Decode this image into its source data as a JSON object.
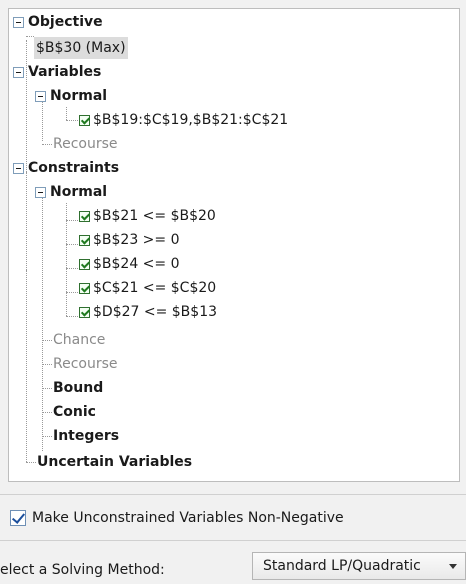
{
  "tree": {
    "objective": {
      "label": "Objective",
      "value": "$B$30 (Max)"
    },
    "variables": {
      "label": "Variables",
      "normal_label": "Normal",
      "normal_items": [
        "$B$19:$C$19,$B$21:$C$21"
      ],
      "recourse_label": "Recourse"
    },
    "constraints": {
      "label": "Constraints",
      "normal_label": "Normal",
      "normal_items": [
        "$B$21 <= $B$20",
        "$B$23 >= 0",
        "$B$24 <= 0",
        "$C$21 <= $C$20",
        "$D$27 <= $B$13"
      ],
      "chance_label": "Chance",
      "recourse_label": "Recourse",
      "bound_label": "Bound",
      "conic_label": "Conic",
      "integers_label": "Integers"
    },
    "uncertain_label": "Uncertain Variables"
  },
  "options": {
    "nonneg_label": "Make Unconstrained Variables Non-Negative",
    "nonneg_checked": true
  },
  "solving": {
    "label": "elect a Solving Method:",
    "selected": "Standard LP/Quadratic"
  }
}
